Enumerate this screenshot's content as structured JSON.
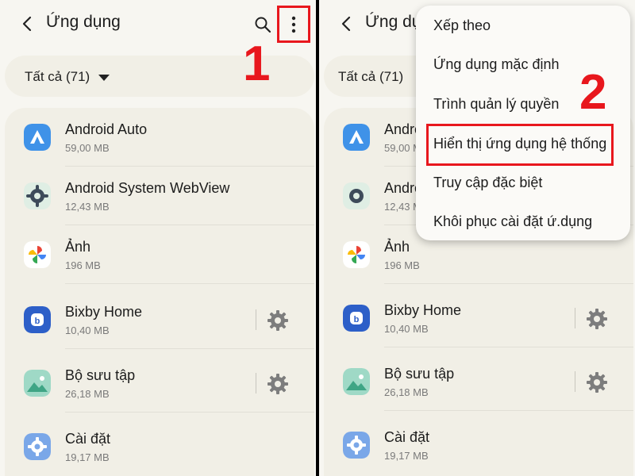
{
  "header": {
    "title": "Ứng dụng"
  },
  "filter": {
    "label": "Tất cả (71)"
  },
  "apps": [
    {
      "name": "Android Auto",
      "size": "59,00 MB",
      "icon": "android-auto-icon"
    },
    {
      "name": "Android System WebView",
      "size": "12,43 MB",
      "icon": "webview-gear-icon"
    },
    {
      "name": "Ảnh",
      "size": "196 MB",
      "icon": "photos-pinwheel-icon"
    },
    {
      "name": "Bixby Home",
      "size": "10,40 MB",
      "icon": "bixby-icon"
    },
    {
      "name": "Bộ sưu tập",
      "size": "26,18 MB",
      "icon": "gallery-icon"
    },
    {
      "name": "Cài đặt",
      "size": "19,17 MB",
      "icon": "settings-gear-icon"
    }
  ],
  "right_panel": {
    "title_visible": "Ứng dụ",
    "filter_visible": "Tất cả (71)",
    "app_names_visible": [
      "Andro",
      "Andro",
      "Ảnh",
      "Bixby Home",
      "Bộ sưu tập",
      "Cài đặt"
    ]
  },
  "menu": {
    "items": [
      "Xếp theo",
      "Ứng dụng mặc định",
      "Trình quản lý quyền",
      "Hiển thị ứng dụng hệ thống",
      "Truy cập đặc biệt",
      "Khôi phục cài đặt ứ.dụng"
    ]
  },
  "annotations": {
    "step1": "1",
    "step2": "2"
  },
  "colors": {
    "highlight": "#e8171d",
    "background": "#f7f6f1",
    "card": "#f1efe6"
  }
}
